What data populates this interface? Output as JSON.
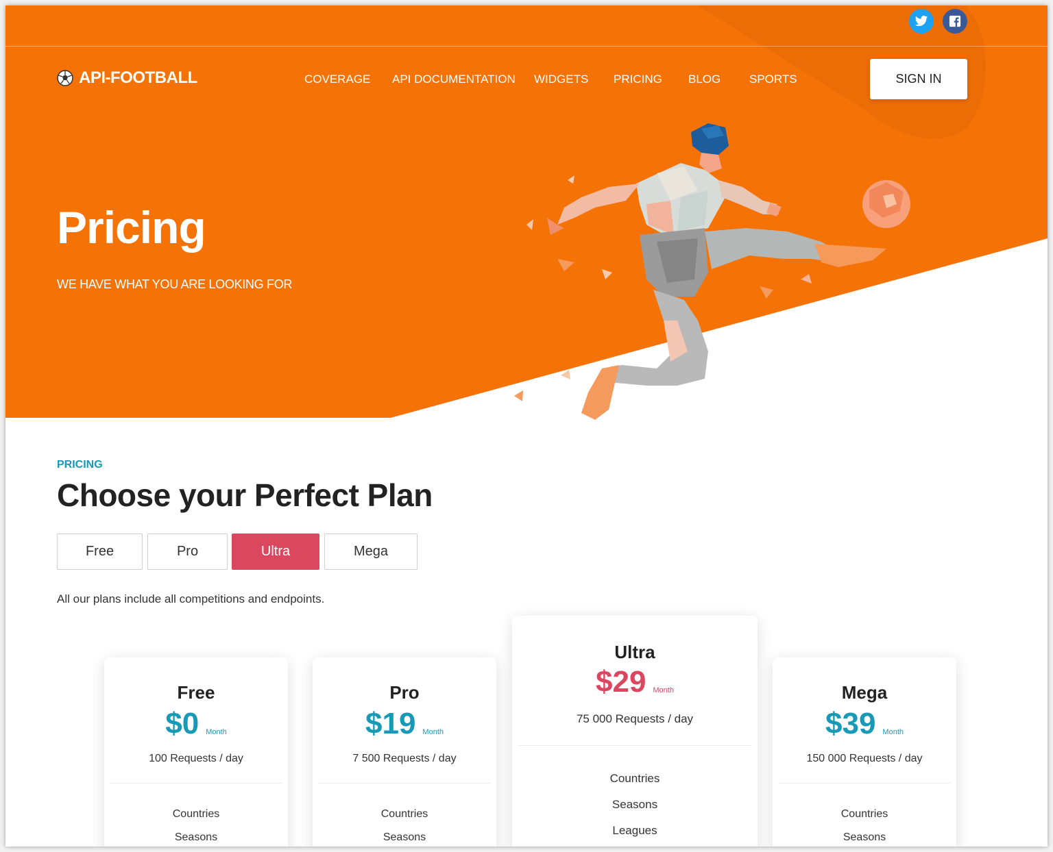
{
  "social": {
    "twitter_glyph": "t",
    "facebook_glyph": "f"
  },
  "brand": {
    "name": "API-FOOTBALL"
  },
  "nav": {
    "items": [
      "COVERAGE",
      "API DOCUMENTATION",
      "WIDGETS",
      "PRICING",
      "BLOG",
      "SPORTS"
    ]
  },
  "header": {
    "signin_label": "SIGN IN"
  },
  "hero": {
    "title": "Pricing",
    "subtitle": "WE HAVE WHAT YOU ARE LOOKING FOR"
  },
  "section": {
    "eyebrow": "PRICING",
    "title": "Choose your Perfect Plan",
    "note": "All our plans include all competitions and endpoints."
  },
  "tabs": [
    {
      "label": "Free",
      "active": false
    },
    {
      "label": "Pro",
      "active": false
    },
    {
      "label": "Ultra",
      "active": true
    },
    {
      "label": "Mega",
      "active": false
    }
  ],
  "plans": [
    {
      "name": "Free",
      "price": "$0",
      "period": "Month",
      "requests": "100 Requests / day",
      "features": [
        "Countries",
        "Seasons"
      ],
      "highlighted": false
    },
    {
      "name": "Pro",
      "price": "$19",
      "period": "Month",
      "requests": "7 500 Requests / day",
      "features": [
        "Countries",
        "Seasons"
      ],
      "highlighted": false
    },
    {
      "name": "Ultra",
      "price": "$29",
      "period": "Month",
      "requests": "75 000 Requests / day",
      "features": [
        "Countries",
        "Seasons",
        "Leagues"
      ],
      "highlighted": true
    },
    {
      "name": "Mega",
      "price": "$39",
      "period": "Month",
      "requests": "150 000 Requests / day",
      "features": [
        "Countries",
        "Seasons"
      ],
      "highlighted": false
    }
  ],
  "colors": {
    "hero": "#f57206",
    "accent_blue": "#1899b6",
    "accent_red": "#dc4760"
  }
}
